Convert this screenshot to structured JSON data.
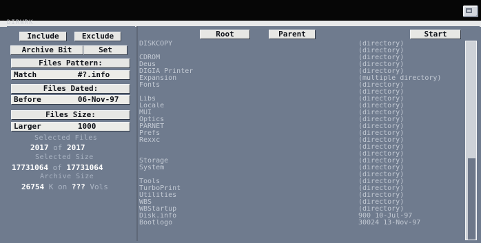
{
  "window": {
    "title": "DIRWRK"
  },
  "left_panel": {
    "include": "Include",
    "exclude": "Exclude",
    "archive_bit": "Archive Bit",
    "set": "Set",
    "files_pattern": "Files Pattern:",
    "match": "Match",
    "pattern": "#?.info",
    "files_dated": "Files Dated:",
    "before": "Before",
    "date": "06-Nov-97",
    "files_size": "Files Size:",
    "larger": "Larger",
    "size_limit": "1000",
    "selected_files_label": "Selected Files",
    "selected_files": "2017",
    "of_label": "of",
    "total_files": "2017",
    "selected_size_label": "Selected Size",
    "selected_size": "17731064",
    "of_label_2": "of",
    "total_size": "17731064",
    "archive_size_label": "Archive Size",
    "archive_size": "26754",
    "archive_unit": "K on",
    "archive_vols": "???",
    "vols_label": "Vols"
  },
  "top_buttons": {
    "root": "Root",
    "parent": "Parent",
    "start": "Start"
  },
  "files": [
    {
      "name": "DISKCOPY",
      "size": "(directory)"
    },
    {
      "name": "",
      "size": "(directory)"
    },
    {
      "name": "CDROM",
      "size": "(directory)"
    },
    {
      "name": "Deus",
      "size": "(directory)"
    },
    {
      "name": "DIGIA Printer",
      "size": "(directory)"
    },
    {
      "name": "Expansion",
      "size": "(multiple directory)"
    },
    {
      "name": "Fonts",
      "size": "(directory)"
    },
    {
      "name": "",
      "size": "(directory)"
    },
    {
      "name": "Libs",
      "size": "(directory)"
    },
    {
      "name": "Locale",
      "size": "(directory)"
    },
    {
      "name": "MUI",
      "size": "(directory)"
    },
    {
      "name": "Optics",
      "size": "(directory)"
    },
    {
      "name": "PARNET",
      "size": "(directory)"
    },
    {
      "name": "Prefs",
      "size": "(directory)"
    },
    {
      "name": "Rexxc",
      "size": "(directory)"
    },
    {
      "name": "",
      "size": "(directory)"
    },
    {
      "name": "",
      "size": "(directory)"
    },
    {
      "name": "Storage",
      "size": "(directory)"
    },
    {
      "name": "System",
      "size": "(directory)"
    },
    {
      "name": "",
      "size": "(directory)"
    },
    {
      "name": "Tools",
      "size": "(directory)"
    },
    {
      "name": "TurboPrint",
      "size": "(directory)"
    },
    {
      "name": "Utilities",
      "size": "(directory)"
    },
    {
      "name": "WBS",
      "size": "(directory)"
    },
    {
      "name": "WBStartup",
      "size": "(directory)"
    },
    {
      "name": "Disk.info",
      "size": "900  10-Jul-97"
    },
    {
      "name": "Bootlogo",
      "size": "30024  13-Nov-97"
    }
  ]
}
